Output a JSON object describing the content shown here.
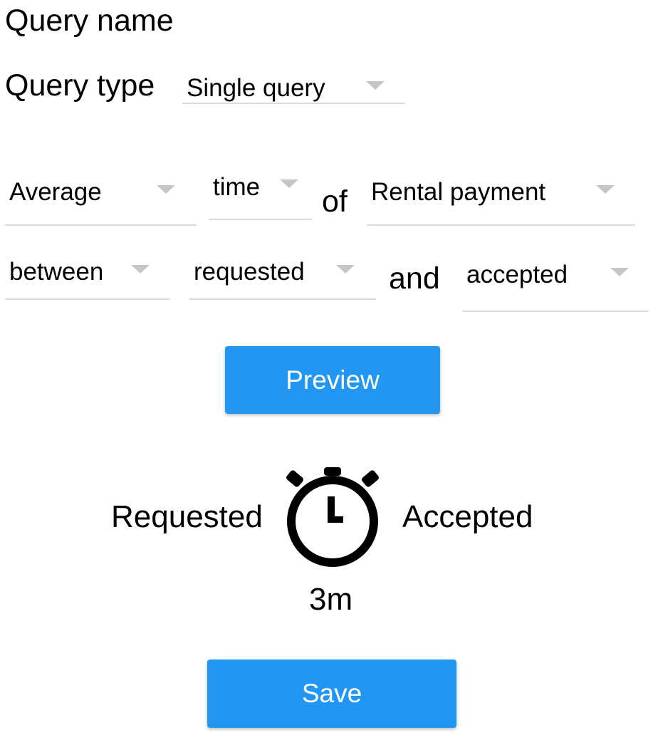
{
  "query_name_label": "Query name",
  "query_type_label": "Query type",
  "query_type_value": "Single query",
  "row1": {
    "aggregate": "Average",
    "metric": "time",
    "of_text": "of",
    "entity": "Rental payment"
  },
  "row2": {
    "between": "between",
    "from_status": "requested",
    "and_text": "and",
    "to_status": "accepted"
  },
  "buttons": {
    "preview": "Preview",
    "save": "Save"
  },
  "result": {
    "start_label": "Requested",
    "end_label": "Accepted",
    "duration": "3m",
    "icon": "stopwatch-icon"
  },
  "colors": {
    "accent": "#2196f3",
    "underline": "#dcdcdc",
    "caret": "#c6c6c6"
  }
}
